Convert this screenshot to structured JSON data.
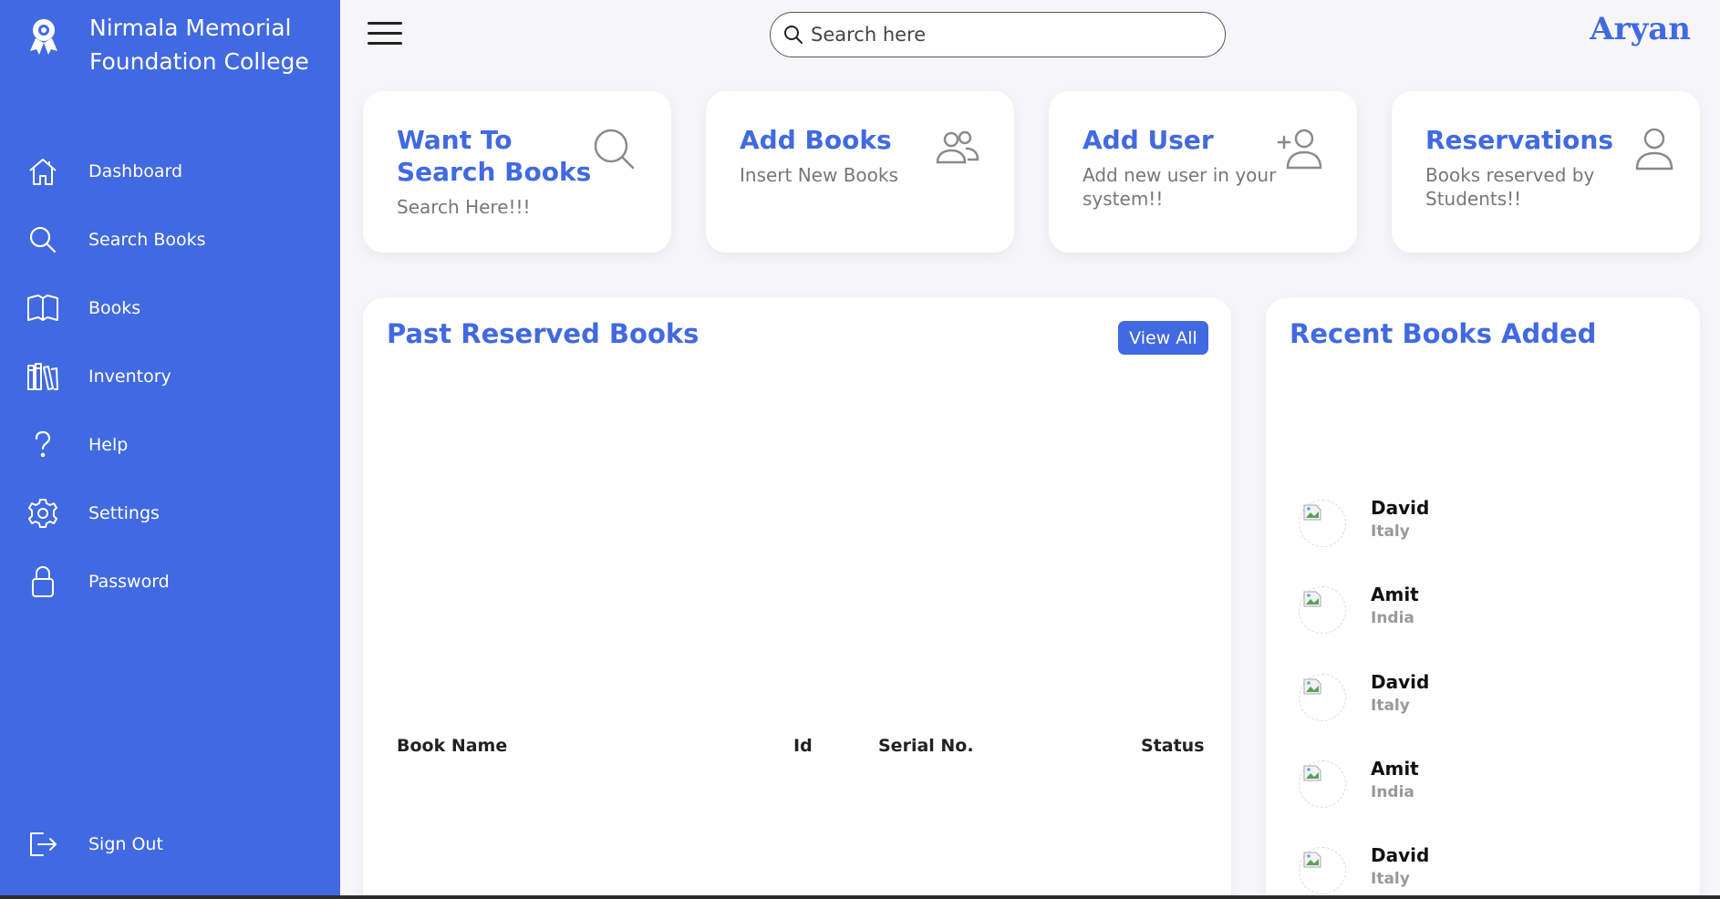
{
  "brand": {
    "title": "Nirmala Memorial Foundation College",
    "icon": "award-ribbon-icon"
  },
  "sidebar": {
    "items": [
      {
        "label": "Dashboard",
        "icon": "home-icon"
      },
      {
        "label": "Search Books",
        "icon": "search-icon"
      },
      {
        "label": "Books",
        "icon": "book-open-icon"
      },
      {
        "label": "Inventory",
        "icon": "library-icon"
      },
      {
        "label": "Help",
        "icon": "help-icon"
      },
      {
        "label": "Settings",
        "icon": "gear-icon"
      },
      {
        "label": "Password",
        "icon": "lock-icon"
      }
    ],
    "signout": {
      "label": "Sign Out",
      "icon": "sign-out-icon"
    }
  },
  "header": {
    "search_placeholder": "Search here",
    "username": "Aryan"
  },
  "cards": [
    {
      "title": "Want To Search Books",
      "subtitle": "Search Here!!!",
      "icon": "search-icon"
    },
    {
      "title": "Add Books",
      "subtitle": "Insert New Books",
      "icon": "users-icon"
    },
    {
      "title": "Add User",
      "subtitle": "Add new user in your system!!",
      "icon": "add-user-icon"
    },
    {
      "title": "Reservations",
      "subtitle": "Books reserved by Students!!",
      "icon": "user-icon"
    }
  ],
  "past_reserved": {
    "title": "Past Reserved Books",
    "view_all": "View All",
    "columns": [
      "Book Name",
      "Id",
      "Serial No.",
      "Status"
    ]
  },
  "recent_books": {
    "title": "Recent Books Added",
    "items": [
      {
        "name": "David",
        "country": "Italy"
      },
      {
        "name": "Amit",
        "country": "India"
      },
      {
        "name": "David",
        "country": "Italy"
      },
      {
        "name": "Amit",
        "country": "India"
      },
      {
        "name": "David",
        "country": "Italy"
      }
    ]
  },
  "colors": {
    "primary": "#4169e1",
    "background": "#f6f6f9",
    "card_subtitle": "#777777",
    "icon_gray": "#8a8a8a"
  }
}
